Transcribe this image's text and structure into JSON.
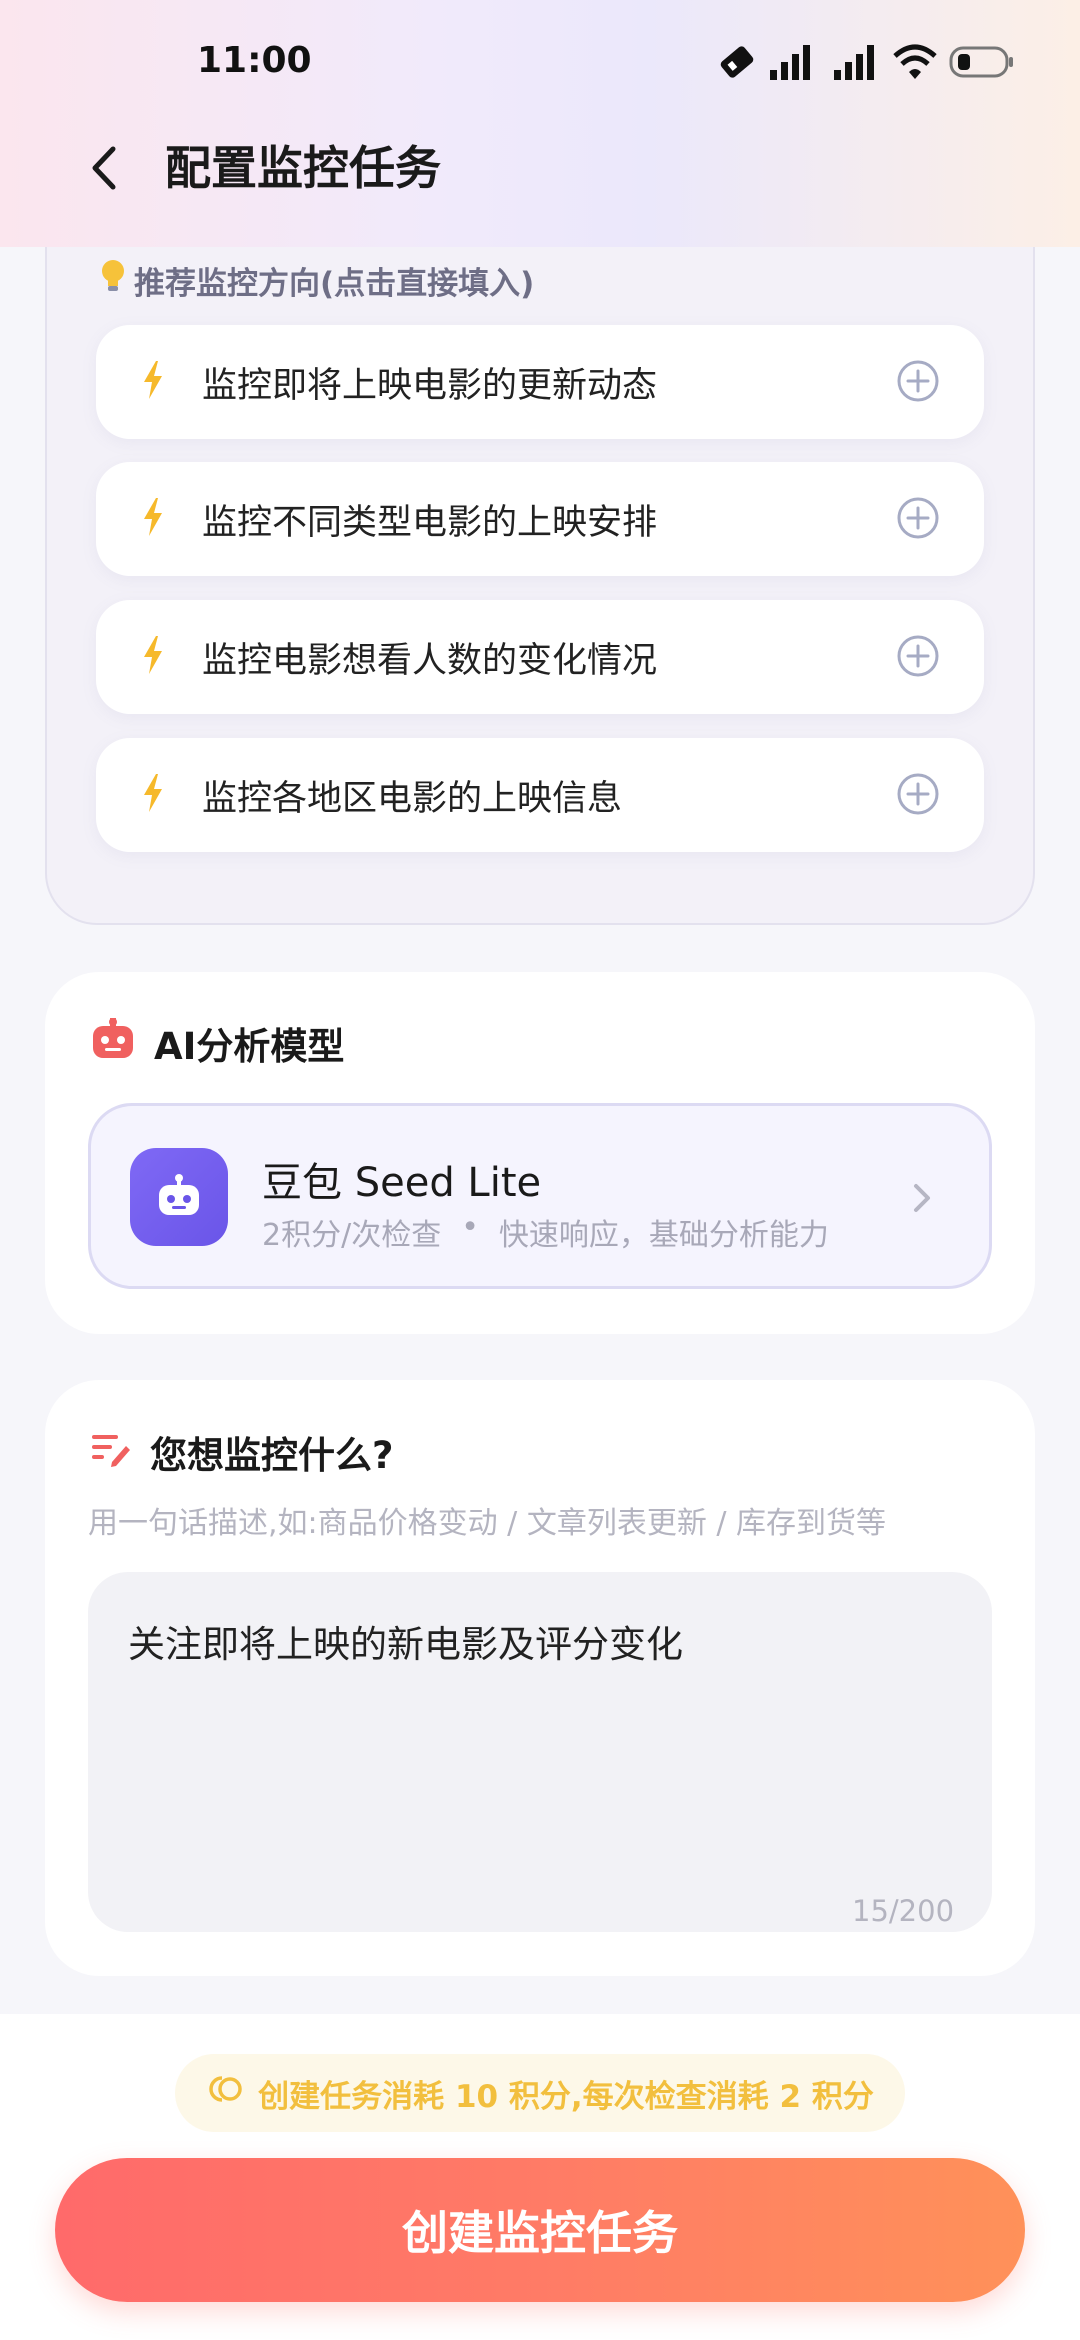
{
  "status_bar": {
    "time": "11:00"
  },
  "header": {
    "title": "配置监控任务"
  },
  "suggestions": {
    "heading": "推荐监控方向(点击直接填入)",
    "items": [
      {
        "label": "监控即将上映电影的更新动态"
      },
      {
        "label": "监控不同类型电影的上映安排"
      },
      {
        "label": "监控电影想看人数的变化情况"
      },
      {
        "label": "监控各地区电影的上映信息"
      }
    ]
  },
  "model": {
    "heading": "AI分析模型",
    "name": "豆包 Seed Lite",
    "cost": "2积分/次检查",
    "separator": "•",
    "description": "快速响应，基础分析能力"
  },
  "monitor_input": {
    "heading": "您想监控什么?",
    "hint": "用一句话描述,如:商品价格变动 / 文章列表更新 / 库存到货等",
    "value": "关注即将上映的新电影及评分变化",
    "counter": "15/200"
  },
  "footer": {
    "cost_notice": "创建任务消耗 10 积分,每次检查消耗 2 积分",
    "create_button": "创建监控任务"
  },
  "colors": {
    "accent_orange": "#ff7b66",
    "model_purple": "#7f69f5",
    "bolt_yellow": "#f6b92b",
    "notice_gold": "#f2bf3e"
  }
}
